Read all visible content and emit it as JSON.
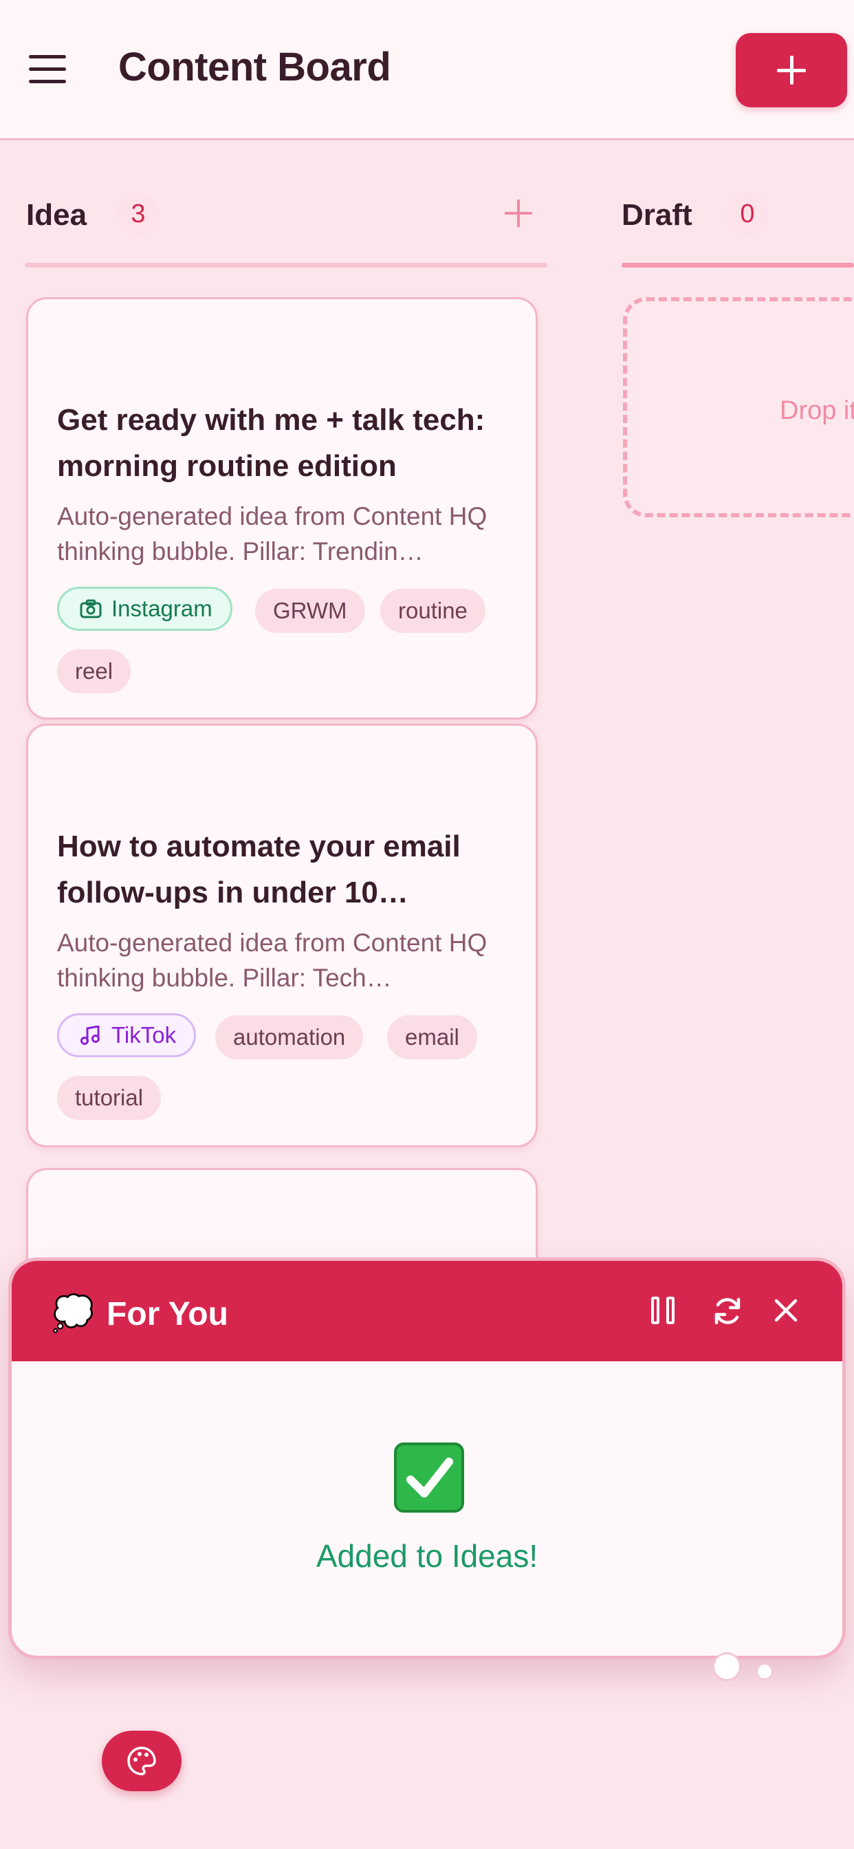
{
  "header": {
    "title": "Content Board",
    "add_label": "+"
  },
  "columns": [
    {
      "title": "Idea",
      "count": "3"
    },
    {
      "title": "Draft",
      "count": "0",
      "drop_text": "Drop it"
    }
  ],
  "cards": [
    {
      "title": "Get ready with me + talk tech: morning routine edition",
      "description": "Auto-generated idea from Content HQ thinking bubble. Pillar: Trendin…",
      "platform": "Instagram",
      "tags": [
        "GRWM",
        "routine",
        "reel"
      ]
    },
    {
      "title": "How to automate your email follow-ups in under 10…",
      "description": "Auto-generated idea from Content HQ thinking bubble. Pillar: Tech…",
      "platform": "TikTok",
      "tags": [
        "automation",
        "email",
        "tutorial"
      ]
    }
  ],
  "popup": {
    "bubble_icon": "💭",
    "title": "For You",
    "message": "Added to Ideas!"
  },
  "colors": {
    "accent": "#d7264e",
    "background": "#fce6ec",
    "success": "#1a9a66"
  }
}
